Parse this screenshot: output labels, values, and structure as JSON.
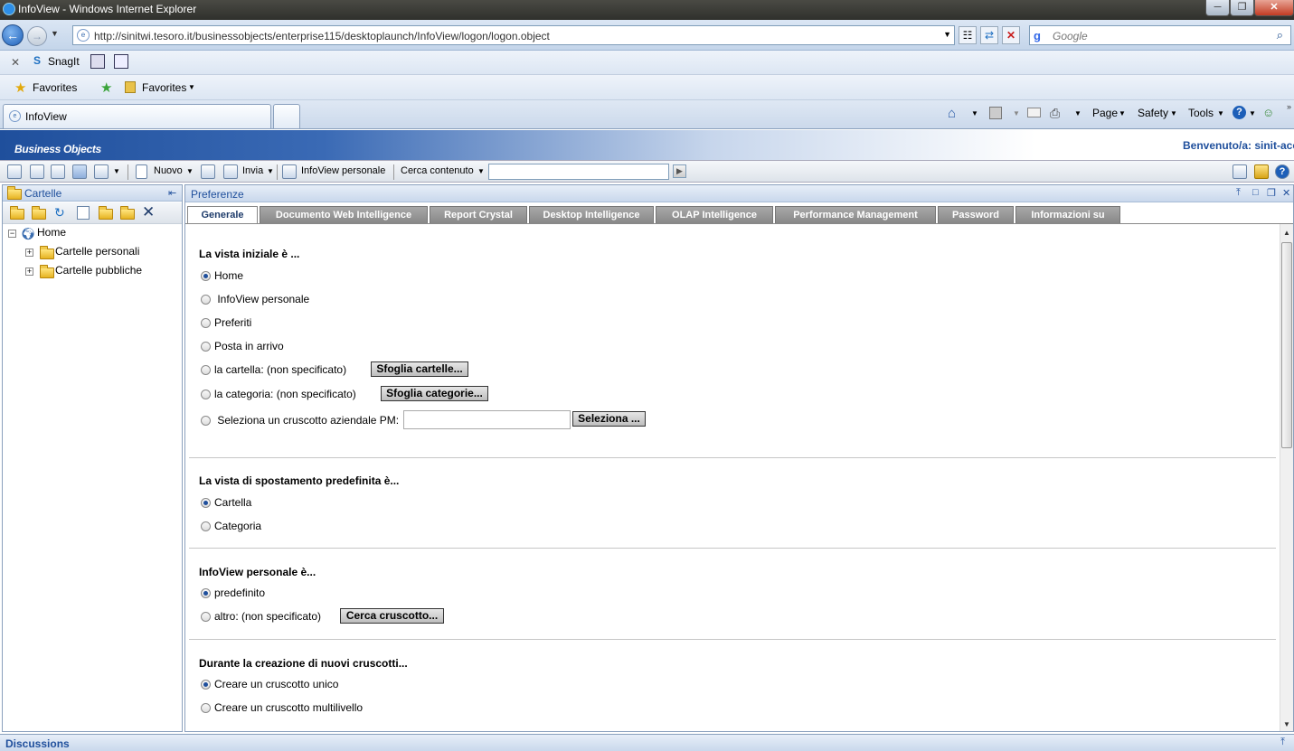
{
  "window": {
    "title": "InfoView - Windows Internet Explorer",
    "min": "─",
    "max": "❐",
    "close": "✕"
  },
  "address": {
    "url": "http://sinitwi.tesoro.it/businessobjects/enterprise115/desktoplaunch/InfoView/logon/logon.object",
    "search_placeholder": "Google"
  },
  "snagit": {
    "label": "SnagIt"
  },
  "favorites": {
    "label": "Favorites",
    "menu_label": "Favorites"
  },
  "tabs": {
    "active": "InfoView"
  },
  "commandbar": {
    "page": "Page",
    "safety": "Safety",
    "tools": "Tools"
  },
  "bo": {
    "logo": "Business Objects",
    "welcome": "Benvenuto/a:  sinit-acc"
  },
  "toolbar": {
    "nuovo": "Nuovo",
    "invia": "Invia",
    "infoview_personale": "InfoView personale",
    "cerca": "Cerca contenuto",
    "search_value": ""
  },
  "left": {
    "title": "Cartelle",
    "tree": {
      "root": "Home",
      "items": [
        "Cartelle personali",
        "Cartelle pubbliche"
      ]
    }
  },
  "right": {
    "title": "Preferenze",
    "tabs": [
      "Generale",
      "Documento Web Intelligence",
      "Report Crystal",
      "Desktop Intelligence",
      "OLAP Intelligence",
      "Performance Management",
      "Password",
      "Informazioni su"
    ],
    "s1": {
      "heading": "La vista iniziale è ...",
      "opt_home": "Home",
      "opt_infoview": " InfoView personale",
      "opt_preferiti": "Preferiti",
      "opt_posta": "Posta in arrivo",
      "opt_cartella": "la cartella:   (non specificato)",
      "btn_cartelle": "Sfoglia cartelle...",
      "opt_categoria": "la categoria:   (non specificato)",
      "btn_categorie": "Sfoglia categorie...",
      "opt_pm": " Seleziona un cruscotto aziendale PM:",
      "btn_seleziona": "Seleziona ..."
    },
    "s2": {
      "heading": "La vista di spostamento predefinita è...",
      "opt_cartella": "Cartella",
      "opt_categoria": "Categoria"
    },
    "s3": {
      "heading": "InfoView personale è...",
      "opt_predefinito": "predefinito",
      "opt_altro": "altro: (non specificato)",
      "btn_cerca": "Cerca cruscotto..."
    },
    "s4": {
      "heading": "Durante la creazione di nuovi cruscotti...",
      "opt_unico": "Creare un cruscotto unico",
      "opt_multi": "Creare un cruscotto multilivello"
    }
  },
  "footer": {
    "label": "Discussions"
  }
}
